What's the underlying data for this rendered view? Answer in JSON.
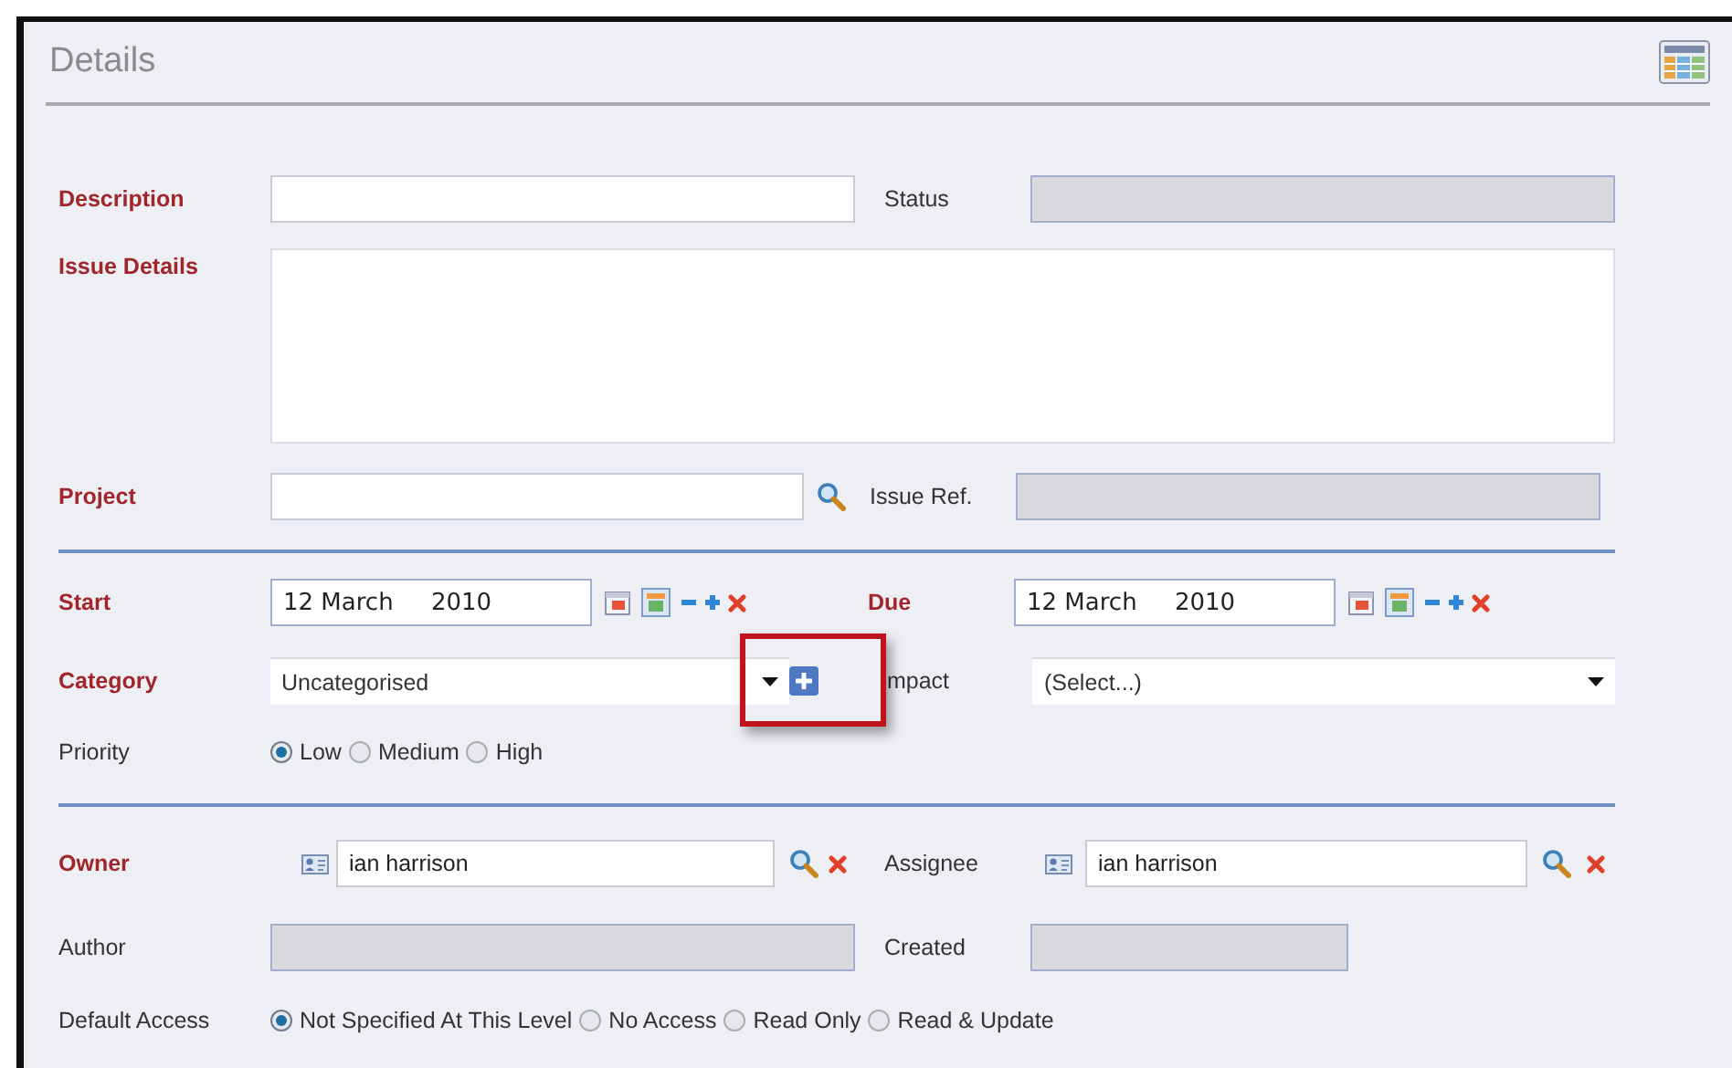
{
  "panel": {
    "title": "Details"
  },
  "description": {
    "label": "Description",
    "required": true,
    "disabled": false
  },
  "status": {
    "label": "Status",
    "required": false,
    "disabled": true
  },
  "issue_details": {
    "label": "Issue Details",
    "required": true
  },
  "project": {
    "label": "Project",
    "required": true,
    "disabled": false
  },
  "issue_ref": {
    "label": "Issue Ref.",
    "required": false,
    "disabled": true
  },
  "start": {
    "label": "Start",
    "required": true,
    "value": "12 March     2010"
  },
  "due": {
    "label": "Due",
    "required": true,
    "value": "12 March     2010"
  },
  "category": {
    "label": "Category",
    "required": true,
    "value": "Uncategorised"
  },
  "impact": {
    "label": "mpact",
    "required": false,
    "value": "(Select...)"
  },
  "priority": {
    "label": "Priority",
    "required": false,
    "options": [
      {
        "label": "Low",
        "selected": true
      },
      {
        "label": "Medium",
        "selected": false
      },
      {
        "label": "High",
        "selected": false
      }
    ]
  },
  "owner": {
    "label": "Owner",
    "required": true,
    "value": "ian harrison"
  },
  "assignee": {
    "label": "Assignee",
    "required": false,
    "value": "ian harrison"
  },
  "author": {
    "label": "Author",
    "required": false,
    "disabled": true
  },
  "created": {
    "label": "Created",
    "required": false,
    "disabled": true
  },
  "default_access": {
    "label": "Default Access",
    "required": false,
    "options": [
      {
        "label": "Not Specified At This Level",
        "selected": true
      },
      {
        "label": "No Access",
        "selected": false
      },
      {
        "label": "Read Only",
        "selected": false
      },
      {
        "label": "Read & Update",
        "selected": false
      }
    ]
  }
}
